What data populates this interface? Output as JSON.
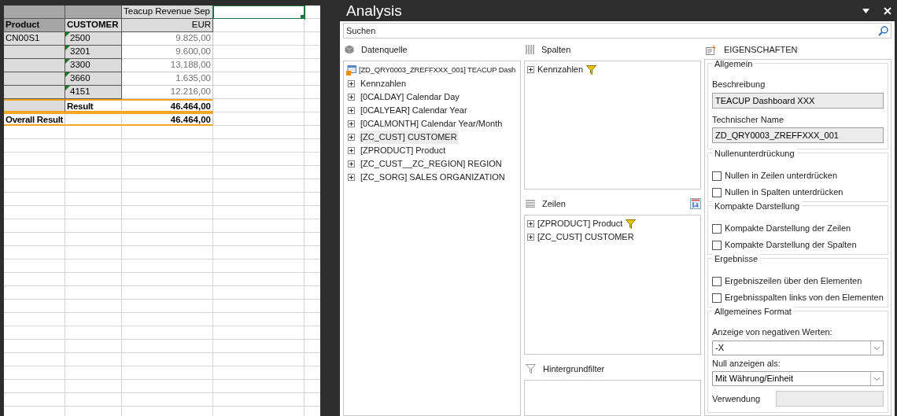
{
  "sheet": {
    "rows": [
      {
        "total": false,
        "cells": [
          {
            "kind": "dark",
            "selected": false
          },
          {
            "kind": "dark",
            "selected": false
          },
          {
            "kind": "measure",
            "text": "Teacup Revenue Sep",
            "selected": false
          },
          {
            "kind": "blank",
            "selected": true
          }
        ]
      },
      {
        "total": false,
        "cells": [
          {
            "kind": "axis-head",
            "text": "Product",
            "selected": false
          },
          {
            "kind": "col-head",
            "text": "CUSTOMER",
            "selected": false
          },
          {
            "kind": "unit",
            "text": "EUR",
            "selected": false
          },
          {
            "kind": "blank",
            "selected": false
          }
        ]
      },
      {
        "total": false,
        "cells": [
          {
            "kind": "member",
            "text": "CN00S1",
            "selected": false
          },
          {
            "kind": "key",
            "text": "2500",
            "selected": false
          },
          {
            "kind": "value",
            "text": "9.825,00",
            "selected": false
          },
          {
            "kind": "blank",
            "selected": false
          }
        ]
      },
      {
        "total": false,
        "cells": [
          {
            "kind": "member",
            "selected": false
          },
          {
            "kind": "key",
            "text": "3201",
            "selected": false
          },
          {
            "kind": "value",
            "text": "9.600,00",
            "selected": false
          },
          {
            "kind": "blank",
            "selected": false
          }
        ]
      },
      {
        "total": false,
        "cells": [
          {
            "kind": "member",
            "selected": false
          },
          {
            "kind": "key",
            "text": "3300",
            "selected": false
          },
          {
            "kind": "value",
            "text": "13.188,00",
            "selected": false
          },
          {
            "kind": "blank",
            "selected": false
          }
        ]
      },
      {
        "total": false,
        "cells": [
          {
            "kind": "member",
            "selected": false
          },
          {
            "kind": "key",
            "text": "3660",
            "selected": false
          },
          {
            "kind": "value",
            "text": "1.635,00",
            "selected": false
          },
          {
            "kind": "blank",
            "selected": false
          }
        ]
      },
      {
        "total": false,
        "cells": [
          {
            "kind": "member",
            "selected": false
          },
          {
            "kind": "key",
            "text": "4151",
            "selected": false
          },
          {
            "kind": "value",
            "text": "12.216,00",
            "selected": false
          },
          {
            "kind": "blank",
            "selected": false
          }
        ]
      },
      {
        "total": true,
        "cells": [
          {
            "kind": "member",
            "selected": false
          },
          {
            "kind": "total-label",
            "text": "Result",
            "selected": false
          },
          {
            "kind": "total",
            "text": "46.464,00",
            "selected": false
          },
          {
            "kind": "blank",
            "selected": false
          }
        ]
      },
      {
        "total": true,
        "cells": [
          {
            "kind": "total-label",
            "text": "Overall Result",
            "selected": false
          },
          {
            "kind": "blank",
            "selected": false
          },
          {
            "kind": "total",
            "text": "46.464,00",
            "selected": false
          },
          {
            "kind": "blank",
            "selected": false
          }
        ]
      }
    ]
  },
  "panel": {
    "title": "Analysis",
    "search": {
      "placeholder": "Suchen"
    },
    "datasource": {
      "title": "Datenquelle",
      "root": "[ZD_QRY0003_ZREFFXXX_001] TEACUP Dash",
      "items": [
        {
          "label": "Kennzahlen",
          "selected": false
        },
        {
          "label": "[0CALDAY] Calendar Day",
          "selected": false
        },
        {
          "label": "[0CALYEAR] Calendar Year",
          "selected": false
        },
        {
          "label": "[0CALMONTH] Calendar Year/Month",
          "selected": false
        },
        {
          "label": "[ZC_CUST] CUSTOMER",
          "selected": true
        },
        {
          "label": "[ZPRODUCT] Product",
          "selected": false
        },
        {
          "label": "[ZC_CUST__ZC_REGION] REGION",
          "selected": false
        },
        {
          "label": "[ZC_SORG] SALES ORGANIZATION",
          "selected": false
        }
      ]
    },
    "columns": {
      "title": "Spalten",
      "items": [
        {
          "label": "Kennzahlen",
          "filtered": true
        }
      ]
    },
    "rows": {
      "title": "Zeilen",
      "items": [
        {
          "label": "[ZPRODUCT] Product",
          "filtered": true
        },
        {
          "label": "[ZC_CUST] CUSTOMER",
          "filtered": false
        }
      ]
    },
    "background_filter": {
      "title": "Hintergrundfilter"
    },
    "properties": {
      "title": "EIGENSCHAFTEN",
      "groups": [
        {
          "title": "Allgemein",
          "items": [
            {
              "kind": "readonly",
              "label": "Beschreibung",
              "value": "TEACUP Dashboard XXX"
            },
            {
              "kind": "readonly",
              "label": "Technischer Name",
              "value": "ZD_QRY0003_ZREFFXXX_001"
            }
          ]
        },
        {
          "title": "Nullenunterdrückung",
          "items": [
            {
              "kind": "checkbox",
              "label": "Nullen in Zeilen unterdrücken",
              "checked": false
            },
            {
              "kind": "checkbox",
              "label": "Nullen in Spalten unterdrücken",
              "checked": false
            }
          ]
        },
        {
          "title": "Kompakte Darstellung",
          "items": [
            {
              "kind": "checkbox",
              "label": "Kompakte Darstellung der Zeilen",
              "checked": false
            },
            {
              "kind": "checkbox",
              "label": "Kompakte Darstellung der Spalten",
              "checked": false
            }
          ]
        },
        {
          "title": "Ergebnisse",
          "items": [
            {
              "kind": "checkbox",
              "label": "Ergebniszeilen über den Elementen",
              "checked": false
            },
            {
              "kind": "checkbox",
              "label": "Ergebnisspalten links von den Elementen",
              "checked": false
            }
          ]
        },
        {
          "title": "Allgemeines Format",
          "items": [
            {
              "kind": "dropdown",
              "label": "Anzeige von negativen Werten:",
              "value": "-X"
            },
            {
              "kind": "dropdown",
              "label": "Null anzeigen als:",
              "value": "Mit Währung/Einheit"
            },
            {
              "kind": "inline",
              "label": "Verwendung"
            }
          ]
        }
      ]
    }
  }
}
